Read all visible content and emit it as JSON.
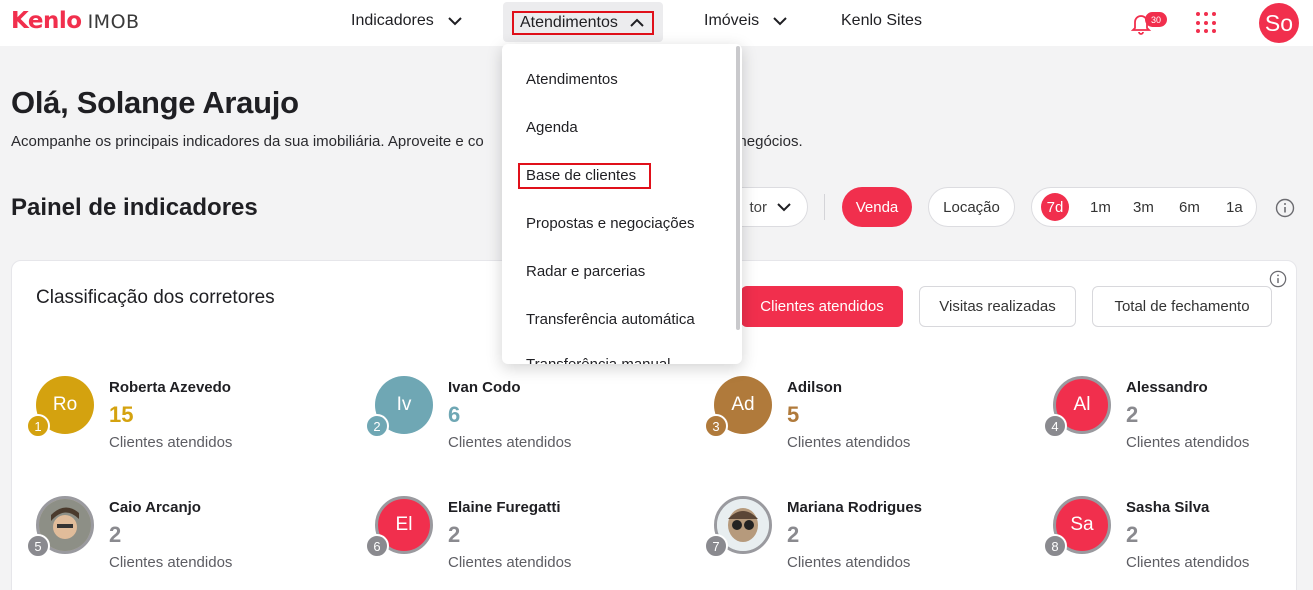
{
  "app": {
    "brand": "Kenlo",
    "product": "IMOB"
  },
  "nav": {
    "items": [
      {
        "label": "Indicadores"
      },
      {
        "label": "Atendimentos"
      },
      {
        "label": "Imóveis"
      },
      {
        "label": "Kenlo Sites"
      }
    ],
    "notifications_count": "30",
    "user_initials": "So"
  },
  "dropdown": {
    "items": [
      "Atendimentos",
      "Agenda",
      "Base de clientes",
      "Propostas e negociações",
      "Radar e parcerias",
      "Transferência automática",
      "Transferência manual"
    ]
  },
  "main": {
    "greeting": "Olá, Solange Araujo",
    "subtitle_start": "Acompanhe os principais indicadores da sua imobiliária. Aproveite e co",
    "subtitle_end": "s negócios.",
    "panel_title": "Painel de indicadores",
    "filter_partial": "tor",
    "business_types": [
      "Venda",
      "Locação"
    ],
    "periods": [
      "7d",
      "1m",
      "3m",
      "6m",
      "1a"
    ]
  },
  "card": {
    "title": "Classificação dos corretores",
    "tabs": [
      "Clientes atendidos",
      "Visitas realizadas",
      "Total de fechamento"
    ],
    "brokers": [
      {
        "rank": "1",
        "initials": "Ro",
        "name": "Roberta Azevedo",
        "count": "15",
        "label": "Clientes atendidos",
        "color": "#d4a20f"
      },
      {
        "rank": "2",
        "initials": "Iv",
        "name": "Ivan Codo",
        "count": "6",
        "label": "Clientes atendidos",
        "color": "#6fa7b4"
      },
      {
        "rank": "3",
        "initials": "Ad",
        "name": "Adilson",
        "count": "5",
        "label": "Clientes atendidos",
        "color": "#b07a3b"
      },
      {
        "rank": "4",
        "initials": "Al",
        "name": "Alessandro",
        "count": "2",
        "label": "Clientes atendidos",
        "color": "#f12f4d"
      },
      {
        "rank": "5",
        "initials": "",
        "name": "Caio Arcanjo",
        "count": "2",
        "label": "Clientes atendidos",
        "color": "#8a8a8f"
      },
      {
        "rank": "6",
        "initials": "El",
        "name": "Elaine Furegatti",
        "count": "2",
        "label": "Clientes atendidos",
        "color": "#f12f4d"
      },
      {
        "rank": "7",
        "initials": "",
        "name": "Mariana Rodrigues",
        "count": "2",
        "label": "Clientes atendidos",
        "color": "#8a8a8f"
      },
      {
        "rank": "8",
        "initials": "Sa",
        "name": "Sasha Silva",
        "count": "2",
        "label": "Clientes atendidos",
        "color": "#f12f4d"
      }
    ]
  },
  "colors": {
    "accent": "#f12f4d",
    "highlight_box": "#e0101a"
  }
}
